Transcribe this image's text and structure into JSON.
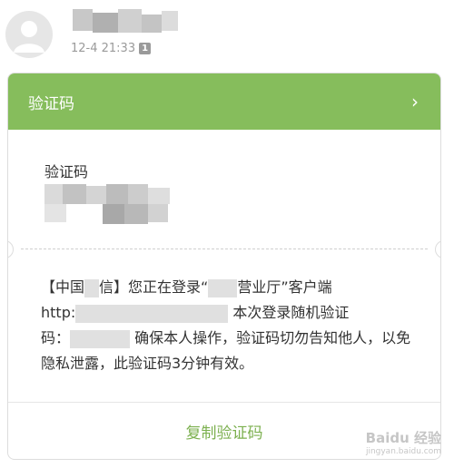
{
  "message_header": {
    "timestamp": "12-4 21:33",
    "sim_badge": "1"
  },
  "card": {
    "header_title": "验证码",
    "code_label": "验证码",
    "message_parts": {
      "p1": "【中国",
      "p2": "信】您正在登录“",
      "p3": "营业厅”客户端",
      "p4": "http:",
      "p5": "本次登录随机验证",
      "p6": "码：",
      "p7": "确保本人操作，验证码切勿告知他人，以免隐私泄露，此验证码3分钟有效。"
    },
    "copy_button": "复制验证码"
  },
  "watermark": {
    "main": "Baidu 经验",
    "sub": "jingyan.baidu.com"
  }
}
